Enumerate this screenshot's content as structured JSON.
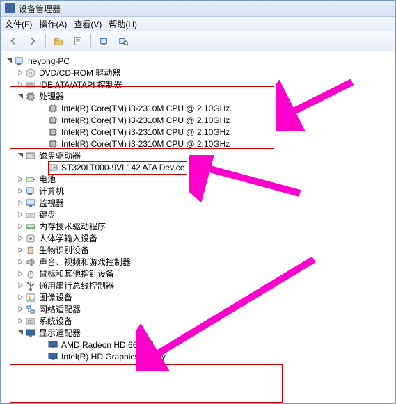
{
  "window": {
    "title": "设备管理器"
  },
  "menu": {
    "file": "文件(F)",
    "action": "操作(A)",
    "view": "查看(V)",
    "help": "帮助(H)"
  },
  "toolbar_icons": {
    "back": "back-icon",
    "fwd": "forward-icon",
    "up": "up-icon",
    "props": "properties-icon",
    "refresh": "refresh-icon",
    "scan": "scan-hardware-icon"
  },
  "tree": {
    "root": "heyong-PC",
    "items": [
      {
        "label": "DVD/CD-ROM 驱动器",
        "icon": "disc"
      },
      {
        "label": "IDE ATA/ATAPI 控制器",
        "icon": "ide"
      },
      {
        "label": "处理器",
        "icon": "cpu",
        "expanded": true,
        "children": [
          "Intel(R) Core(TM) i3-2310M CPU @ 2.10GHz",
          "Intel(R) Core(TM) i3-2310M CPU @ 2.10GHz",
          "Intel(R) Core(TM) i3-2310M CPU @ 2.10GHz",
          "Intel(R) Core(TM) i3-2310M CPU @ 2.10GHz"
        ]
      },
      {
        "label": "磁盘驱动器",
        "icon": "disk",
        "expanded": true,
        "children": [
          "ST320LT000-9VL142 ATA Device"
        ]
      },
      {
        "label": "电池",
        "icon": "battery"
      },
      {
        "label": "计算机",
        "icon": "computer"
      },
      {
        "label": "监视器",
        "icon": "monitor"
      },
      {
        "label": "键盘",
        "icon": "keyboard"
      },
      {
        "label": "内存技术驱动程序",
        "icon": "memory"
      },
      {
        "label": "人体学输入设备",
        "icon": "hid"
      },
      {
        "label": "生物识别设备",
        "icon": "bio"
      },
      {
        "label": "声音、视频和游戏控制器",
        "icon": "sound"
      },
      {
        "label": "鼠标和其他指针设备",
        "icon": "mouse"
      },
      {
        "label": "通用串行总线控制器",
        "icon": "usb"
      },
      {
        "label": "图像设备",
        "icon": "image"
      },
      {
        "label": "网络适配器",
        "icon": "network"
      },
      {
        "label": "系统设备",
        "icon": "system"
      },
      {
        "label": "显示适配器",
        "icon": "display",
        "expanded": true,
        "children": [
          "AMD Radeon HD 6630M",
          "Intel(R) HD Graphics Family"
        ]
      }
    ]
  }
}
